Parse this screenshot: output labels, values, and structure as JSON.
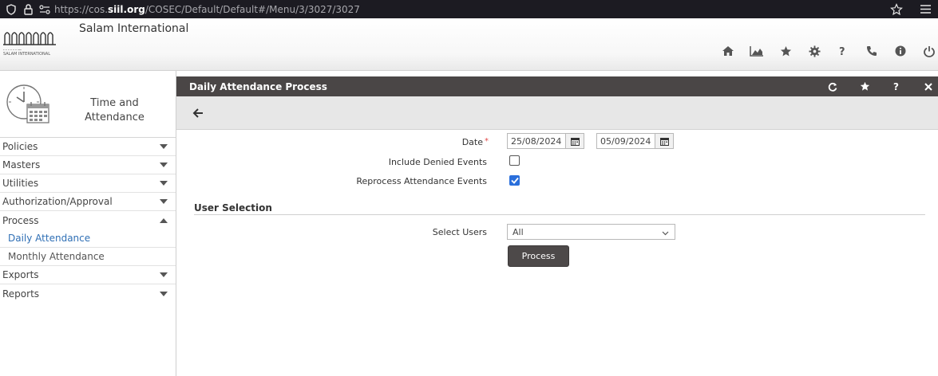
{
  "browser": {
    "url_prefix": "https://cos.",
    "url_domain": "siil.org",
    "url_path": "/COSEC/Default/Default#/Menu/3/3027/3027"
  },
  "header": {
    "brand": "Salam International",
    "logo_caption": "SALAM INTERNATIONAL",
    "icons": [
      "home-icon",
      "dashboard-chart-icon",
      "star-icon",
      "gear-icon",
      "help-icon",
      "phone-icon",
      "info-icon",
      "power-icon"
    ]
  },
  "sidebar": {
    "module_line1": "Time and",
    "module_line2": "Attendance",
    "items": [
      {
        "label": "Policies",
        "state": "collapsed"
      },
      {
        "label": "Masters",
        "state": "collapsed"
      },
      {
        "label": "Utilities",
        "state": "collapsed"
      },
      {
        "label": "Authorization/Approval",
        "state": "collapsed"
      },
      {
        "label": "Process",
        "state": "expanded"
      },
      {
        "label": "Exports",
        "state": "collapsed"
      },
      {
        "label": "Reports",
        "state": "collapsed"
      }
    ],
    "process_subitems": [
      "Daily Attendance",
      "Monthly Attendance"
    ],
    "active_subitem": "Daily Attendance"
  },
  "page": {
    "title": "Daily Attendance Process",
    "date_label": "Date",
    "required_mark": "*",
    "date_from": "25/08/2024",
    "date_to": "05/09/2024",
    "include_denied_label": "Include Denied Events",
    "include_denied_checked": false,
    "reprocess_label": "Reprocess Attendance Events",
    "reprocess_checked": true,
    "section_title": "User Selection",
    "select_users_label": "Select Users",
    "select_users_value": "All",
    "process_button": "Process"
  },
  "colors": {
    "title_bar": "#4a4646",
    "active_link": "#2f6fb5",
    "checkbox_checked": "#2a6fdb",
    "required": "#e24a4a"
  }
}
